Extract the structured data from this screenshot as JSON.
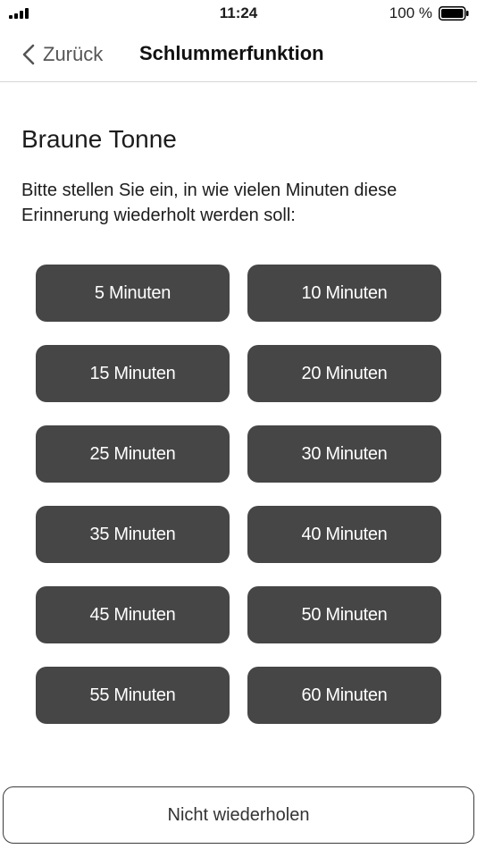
{
  "status_bar": {
    "time": "11:24",
    "battery": "100 %"
  },
  "nav": {
    "back_label": "Zurück",
    "title": "Schlummerfunktion"
  },
  "content": {
    "heading": "Braune Tonne",
    "instruction": "Bitte stellen Sie ein, in wie vielen Minuten diese Erinnerung wiederholt werden soll:"
  },
  "options": [
    "5 Minuten",
    "10 Minuten",
    "15 Minuten",
    "20 Minuten",
    "25 Minuten",
    "30 Minuten",
    "35 Minuten",
    "40 Minuten",
    "45 Minuten",
    "50 Minuten",
    "55 Minuten",
    "60 Minuten"
  ],
  "footer": {
    "no_repeat_label": "Nicht wiederholen"
  },
  "colors": {
    "button_bg": "#464646",
    "button_text": "#ffffff",
    "border": "#3c3c3c"
  }
}
